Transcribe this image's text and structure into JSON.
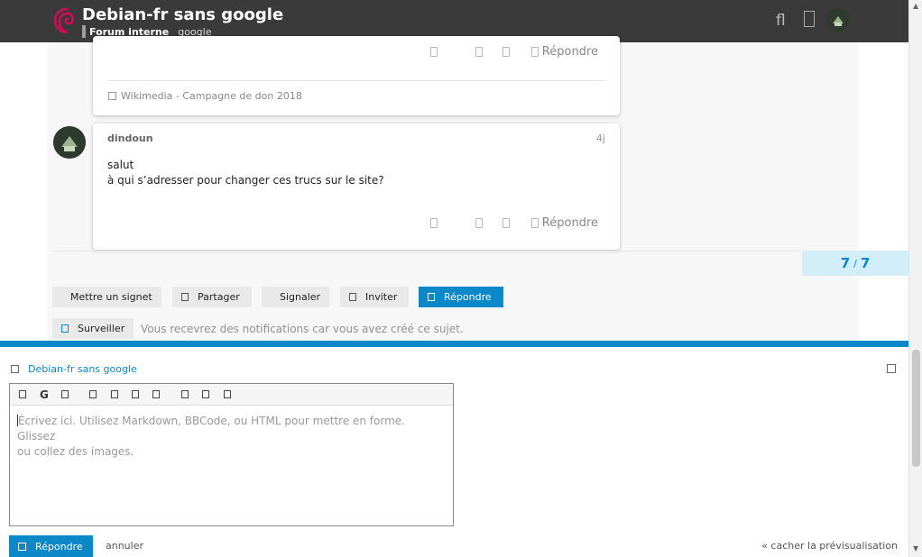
{
  "header": {
    "title": "Debian-fr sans google",
    "category": "Forum interne",
    "tag": "google"
  },
  "posts": [
    {
      "reply_label": "Répondre",
      "link_text": "Wikimedia - Campagne de don 2018"
    },
    {
      "username": "dindoun",
      "age": "4j",
      "body_line1": "salut",
      "body_line2": "à qui s’adresser pour changer ces trucs sur le site?",
      "reply_label": "Répondre"
    }
  ],
  "progress": {
    "current": "7",
    "separator": "/",
    "total": "7"
  },
  "topic_controls": {
    "bookmark": "Mettre un signet",
    "share": "Partager",
    "flag": "Signaler",
    "invite": "Inviter",
    "reply": "Répondre"
  },
  "notifications": {
    "button": "Surveiller",
    "text": "Vous recevrez des notifications car vous avez créé ce sujet."
  },
  "composer": {
    "topic_title": "Debian-fr sans google",
    "toolbar_g": "G",
    "placeholder_line1": "Écrivez ici. Utilisez Markdown, BBCode, ou HTML pour mettre en forme. Glissez",
    "placeholder_line2": "ou collez des images.",
    "submit": "Répondre",
    "cancel": "annuler",
    "hide_preview": "« cacher la prévisualisation"
  },
  "colors": {
    "accent": "#0a88c8",
    "header_bg": "#3a3a3a",
    "progress_bg": "#d1eef9"
  }
}
